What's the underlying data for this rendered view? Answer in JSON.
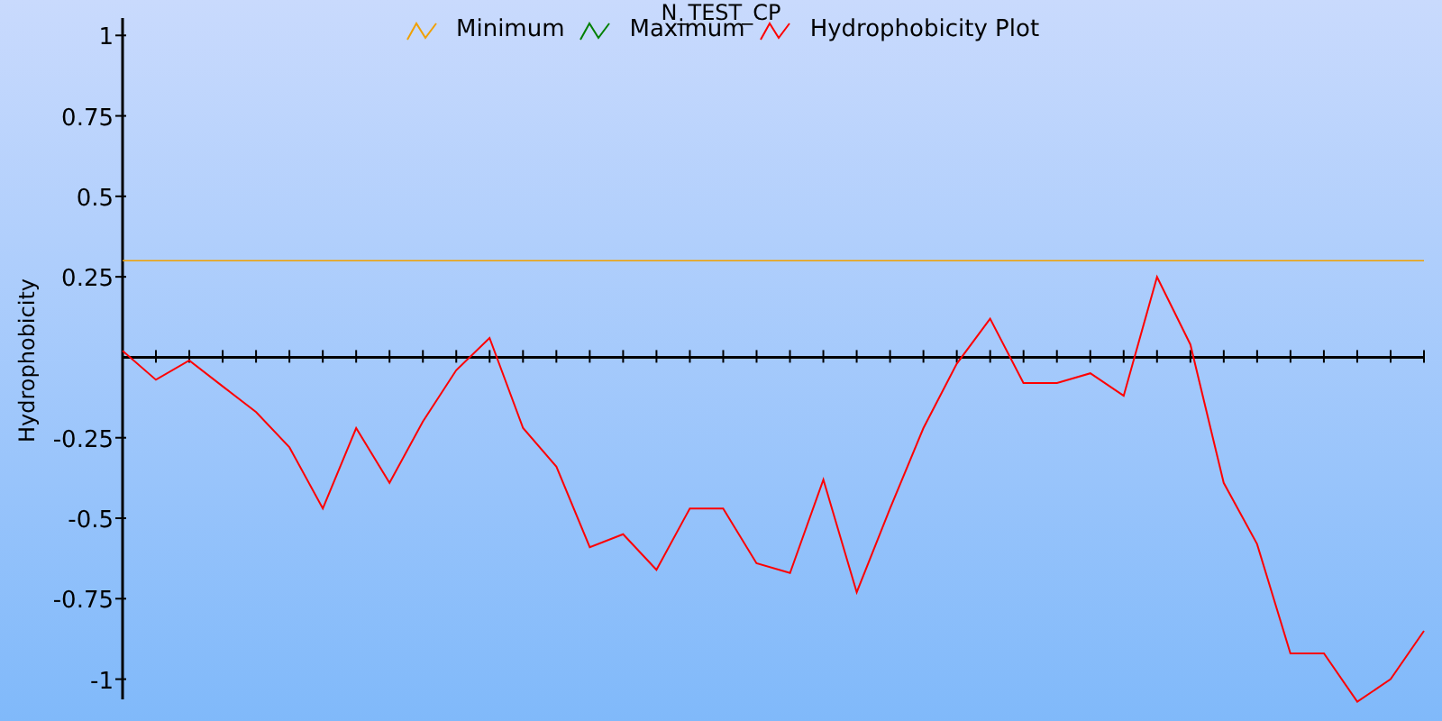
{
  "chart_data": {
    "type": "line",
    "title": "N_TEST_CP",
    "ylabel": "Hydrophobicity",
    "ylim": [
      -1.13,
      1.11
    ],
    "yticks": [
      1,
      0.75,
      0.5,
      0.25,
      -0.25,
      -0.5,
      -0.75,
      -1
    ],
    "legend": "top",
    "series": [
      {
        "name": "Minimum",
        "color": "#f0a000",
        "values": [
          0.3,
          0.3,
          0.3,
          0.3,
          0.3,
          0.3,
          0.3,
          0.3,
          0.3,
          0.3,
          0.3,
          0.3,
          0.3,
          0.3,
          0.3,
          0.3,
          0.3,
          0.3,
          0.3,
          0.3,
          0.3,
          0.3,
          0.3,
          0.3,
          0.3,
          0.3,
          0.3,
          0.3,
          0.3,
          0.3,
          0.3,
          0.3,
          0.3,
          0.3,
          0.3,
          0.3,
          0.3,
          0.3,
          0.3,
          0.3
        ]
      },
      {
        "name": "Maximum",
        "color": "#008000",
        "values": [
          null,
          null,
          null,
          null,
          null,
          null,
          null,
          null,
          null,
          null,
          null,
          null,
          null,
          null,
          null,
          null,
          null,
          null,
          null,
          null,
          null,
          null,
          null,
          null,
          null,
          null,
          null,
          null,
          null,
          null,
          null,
          null,
          null,
          null,
          null,
          null,
          null,
          null,
          null,
          null
        ]
      },
      {
        "name": "Hydrophobicity Plot",
        "color": "#ff0000",
        "values": [
          0.02,
          -0.07,
          -0.01,
          -0.09,
          -0.17,
          -0.28,
          -0.47,
          -0.22,
          -0.39,
          -0.2,
          -0.04,
          0.06,
          -0.22,
          -0.34,
          -0.59,
          -0.55,
          -0.66,
          -0.47,
          -0.47,
          -0.64,
          -0.67,
          -0.38,
          -0.73,
          -0.47,
          -0.22,
          -0.02,
          0.12,
          -0.08,
          -0.08,
          -0.05,
          -0.12,
          0.25,
          0.04,
          -0.39,
          -0.58,
          -0.92,
          -0.92,
          -1.07,
          -1.0,
          -0.85
        ]
      }
    ]
  }
}
